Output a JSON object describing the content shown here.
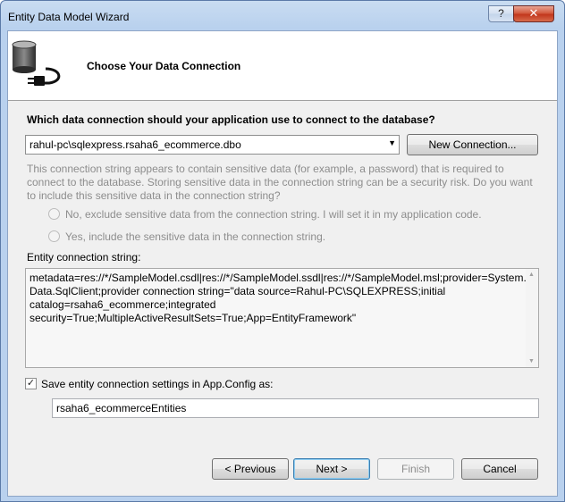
{
  "window": {
    "title": "Entity Data Model Wizard"
  },
  "title_buttons": {
    "help": "?",
    "close": "✕"
  },
  "header": {
    "title": "Choose Your Data Connection",
    "icon": "database-plug-icon"
  },
  "connection": {
    "question": "Which data connection should your application use to connect to the database?",
    "selected": "rahul-pc\\sqlexpress.rsaha6_ecommerce.dbo",
    "new_connection_label": "New Connection..."
  },
  "sensitive": {
    "warning": "This connection string appears to contain sensitive data (for example, a password) that is required to connect to the database. Storing sensitive data in the connection string can be a security risk. Do you want to include this sensitive data in the connection string?",
    "option_no": "No, exclude sensitive data from the connection string. I will set it in my application code.",
    "option_yes": "Yes, include the sensitive data in the connection string."
  },
  "entity_connection": {
    "label": "Entity connection string:",
    "value": "metadata=res://*/SampleModel.csdl|res://*/SampleModel.ssdl|res://*/SampleModel.msl;provider=System.Data.SqlClient;provider connection string=\"data source=Rahul-PC\\SQLEXPRESS;initial catalog=rsaha6_ecommerce;integrated security=True;MultipleActiveResultSets=True;App=EntityFramework\""
  },
  "save_settings": {
    "checked": true,
    "label": "Save entity connection settings in App.Config as:",
    "name": "rsaha6_ecommerceEntities"
  },
  "footer": {
    "previous": "< Previous",
    "next": "Next >",
    "finish": "Finish",
    "cancel": "Cancel"
  },
  "colors": {
    "disabled_text": "#8d8d8d",
    "dialog_bg": "#f0f0f0",
    "header_bg": "#ffffff"
  }
}
